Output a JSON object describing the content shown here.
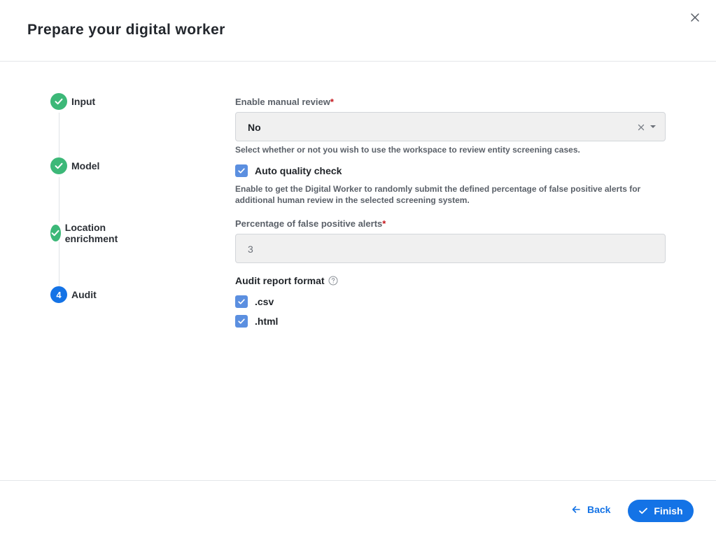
{
  "header": {
    "title": "Prepare your digital worker"
  },
  "stepper": {
    "steps": [
      {
        "label": "Input",
        "status": "done"
      },
      {
        "label": "Model",
        "status": "done"
      },
      {
        "label": "Location enrichment",
        "status": "done"
      },
      {
        "label": "Audit",
        "status": "active",
        "number": "4"
      }
    ]
  },
  "form": {
    "manual_review": {
      "label": "Enable manual review",
      "required_mark": "*",
      "value": "No",
      "help": "Select whether or not you wish to use the workspace to review entity screening cases."
    },
    "auto_quality": {
      "label": "Auto quality check",
      "checked": true,
      "help": "Enable to get the Digital Worker to randomly submit the defined percentage of false positive alerts for additional human review in the selected screening system."
    },
    "false_positive": {
      "label": "Percentage of false positive alerts",
      "required_mark": "*",
      "value": "3"
    },
    "audit_format": {
      "title": "Audit report format",
      "options": [
        {
          "label": ".csv",
          "checked": true
        },
        {
          "label": ".html",
          "checked": true
        }
      ]
    }
  },
  "footer": {
    "back_label": "Back",
    "finish_label": "Finish"
  },
  "colors": {
    "accent": "#1473e6",
    "success": "#3cb878",
    "checkbox": "#5b8fe0",
    "required": "#c4161c"
  }
}
